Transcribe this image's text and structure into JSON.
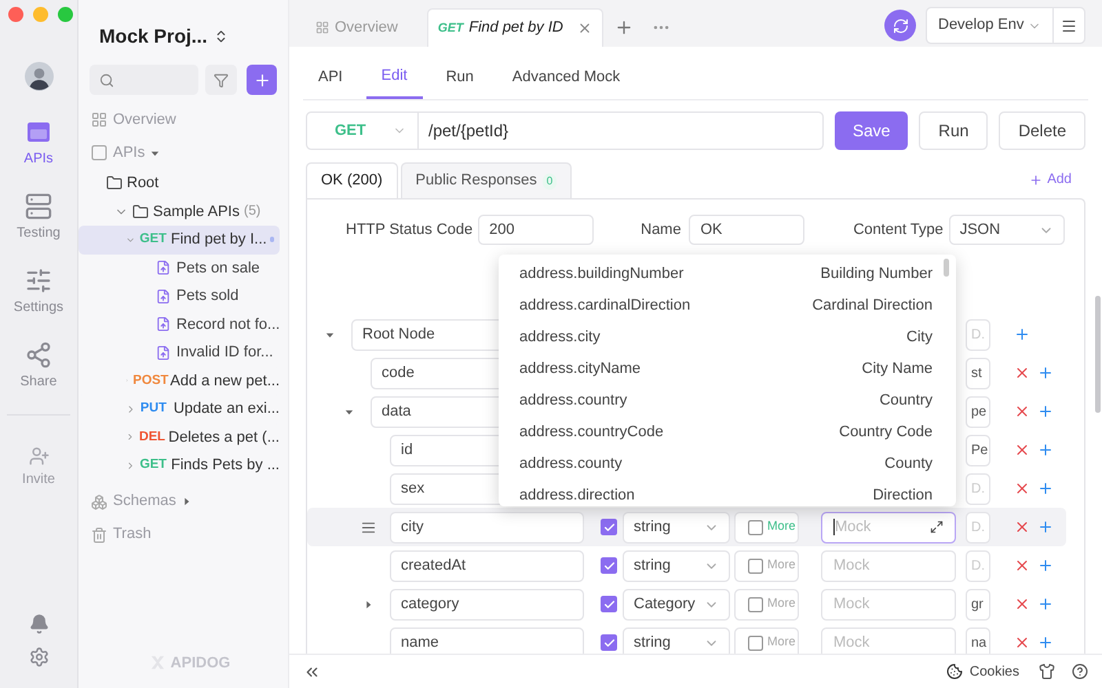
{
  "rail": {
    "items": [
      {
        "kind": "apis",
        "label": "APIs",
        "selected": true
      },
      {
        "kind": "testing",
        "label": "Testing",
        "selected": false
      },
      {
        "kind": "settings",
        "label": "Settings",
        "selected": false
      },
      {
        "kind": "share",
        "label": "Share",
        "selected": false
      }
    ],
    "invite": "Invite"
  },
  "sidebar": {
    "project": "Mock Proj...",
    "nav": [
      {
        "kind": "overview",
        "label": "Overview"
      },
      {
        "kind": "apis",
        "label": "APIs",
        "expanded": true
      }
    ],
    "tree": [
      {
        "kind": "folder",
        "label": "Root",
        "children": [
          {
            "kind": "folder",
            "label": "Sample APIs",
            "count": "(5)",
            "expanded": true,
            "children": [
              {
                "kind": "endpoint",
                "method": "GET",
                "color": "#3dbf8a",
                "label": "Find pet by I...",
                "expanded": true,
                "selected": true,
                "modified": true,
                "children": [
                  {
                    "kind": "example",
                    "label": "Pets on sale"
                  },
                  {
                    "kind": "example",
                    "label": "Pets sold"
                  },
                  {
                    "kind": "example",
                    "label": "Record not fo..."
                  },
                  {
                    "kind": "example",
                    "label": "Invalid ID for..."
                  }
                ]
              },
              {
                "kind": "endpoint",
                "method": "POST",
                "color": "#f0883e",
                "label": "Add a new pet...",
                "expanded": false,
                "selected": false,
                "modified": false
              },
              {
                "kind": "endpoint",
                "method": "PUT",
                "color": "#2f8cf0",
                "label": "Update an exi...",
                "expanded": false,
                "selected": false,
                "modified": false
              },
              {
                "kind": "endpoint",
                "method": "DEL",
                "color": "#ef5533",
                "label": "Deletes a pet (...",
                "expanded": false,
                "selected": false,
                "modified": false
              },
              {
                "kind": "endpoint",
                "method": "GET",
                "color": "#3dbf8a",
                "label": "Finds Pets by ...",
                "expanded": false,
                "selected": false,
                "modified": false
              }
            ]
          }
        ]
      }
    ],
    "bottom": [
      {
        "kind": "schemas",
        "label": "Schemas",
        "expanded": false
      },
      {
        "kind": "trash",
        "label": "Trash"
      }
    ],
    "logo": "APIDOG"
  },
  "tabs": [
    {
      "kind": "overview",
      "label": "Overview",
      "selected": false
    },
    {
      "kind": "endpoint",
      "method": "GET",
      "color": "#3dbf8a",
      "label": "Find pet by ID",
      "selected": true
    }
  ],
  "environment": "Develop Env",
  "subtabs": [
    {
      "label": "API",
      "selected": false
    },
    {
      "label": "Edit",
      "selected": true
    },
    {
      "label": "Run",
      "selected": false
    },
    {
      "label": "Advanced Mock",
      "selected": false
    }
  ],
  "request": {
    "method": "GET",
    "path": "/pet/{petId}",
    "actions": [
      {
        "label": "Save",
        "kind": "primary"
      },
      {
        "label": "Run",
        "kind": "default"
      },
      {
        "label": "Delete",
        "kind": "default"
      }
    ]
  },
  "responses": {
    "tabs": [
      {
        "label": "OK (200)",
        "selected": true
      },
      {
        "label": "Public Responses",
        "count": "0",
        "selected": false
      }
    ],
    "add": "Add"
  },
  "form": {
    "status_label": "HTTP Status Code",
    "status": "200",
    "name_label": "Name",
    "name": "OK",
    "content_type_label": "Content Type",
    "content_type": "JSON"
  },
  "schema": {
    "name": "Root Node",
    "expanded": true,
    "deletable": false,
    "highlighted": false,
    "description_placeholder": "D.",
    "children": [
      {
        "name": "code",
        "deletable": true,
        "highlighted": false,
        "description": "st"
      },
      {
        "name": "data",
        "expanded": true,
        "deletable": true,
        "highlighted": false,
        "description": "pe",
        "children": [
          {
            "name": "id",
            "deletable": true,
            "highlighted": false,
            "description": "Pe"
          },
          {
            "name": "sex",
            "deletable": true,
            "highlighted": false,
            "description_placeholder": "D."
          },
          {
            "name": "city",
            "deletable": true,
            "highlighted": true,
            "required": true,
            "type": "string",
            "nullable": false,
            "more": "More",
            "more_active": true,
            "mock_placeholder": "Mock",
            "focused": true,
            "description_placeholder": "D."
          },
          {
            "name": "createdAt",
            "deletable": true,
            "highlighted": false,
            "required": true,
            "type": "string",
            "nullable": false,
            "more": "More",
            "more_active": false,
            "mock_placeholder": "Mock",
            "focused": false,
            "description_placeholder": "D."
          },
          {
            "name": "category",
            "expanded": false,
            "deletable": true,
            "highlighted": false,
            "required": true,
            "type": "Category",
            "nullable": false,
            "more": "More",
            "more_active": false,
            "mock_placeholder": "Mock",
            "focused": false,
            "description": "gr"
          },
          {
            "name": "name",
            "deletable": true,
            "highlighted": false,
            "required": true,
            "type": "string",
            "nullable": false,
            "more": "More",
            "more_active": false,
            "mock_placeholder": "Mock",
            "focused": false,
            "description": "na"
          }
        ]
      }
    ]
  },
  "mock_dropdown": {
    "items": [
      {
        "path": "address.buildingNumber",
        "label": "Building Number"
      },
      {
        "path": "address.cardinalDirection",
        "label": "Cardinal Direction"
      },
      {
        "path": "address.city",
        "label": "City"
      },
      {
        "path": "address.cityName",
        "label": "City Name"
      },
      {
        "path": "address.country",
        "label": "Country"
      },
      {
        "path": "address.countryCode",
        "label": "Country Code"
      },
      {
        "path": "address.county",
        "label": "County"
      },
      {
        "path": "address.direction",
        "label": "Direction"
      }
    ]
  },
  "footer": {
    "cookies": "Cookies"
  }
}
